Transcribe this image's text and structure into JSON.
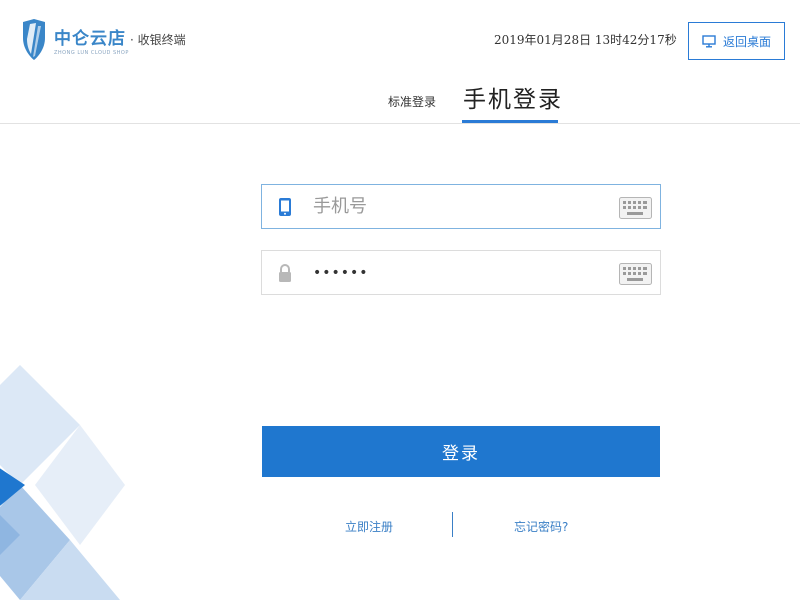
{
  "header": {
    "brand_name": "中仑云店",
    "brand_suffix": "· 收银终端",
    "brand_english": "ZHONG LUN CLOUD SHOP",
    "datetime": "2019年01月28日 13时42分17秒",
    "back_button_label": "返回桌面",
    "monitor_icon": "monitor-icon"
  },
  "tabs": [
    {
      "label": "标准登录",
      "active": false
    },
    {
      "label": "手机登录",
      "active": true
    }
  ],
  "form": {
    "phone": {
      "placeholder": "手机号",
      "value": "",
      "icon": "mobile-phone-icon"
    },
    "password": {
      "value": "••••••",
      "icon": "lock-icon"
    },
    "keyboard_icon": "keyboard-icon",
    "login_label": "登录"
  },
  "links": {
    "register": "立即注册",
    "forgot": "忘记密码?"
  },
  "colors": {
    "accent": "#1f77cf",
    "link": "#3a7fc6",
    "focus_border": "#7fb3e0"
  }
}
